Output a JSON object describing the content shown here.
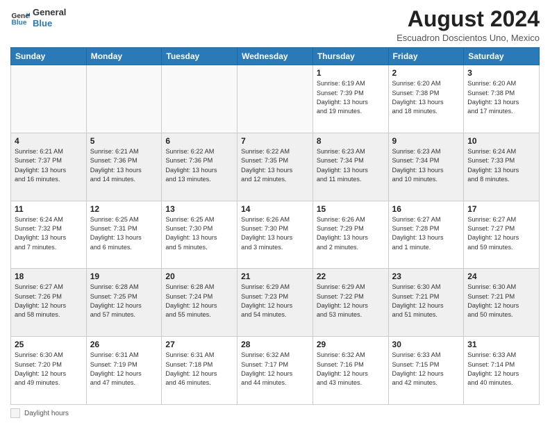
{
  "header": {
    "logo_line1": "General",
    "logo_line2": "Blue",
    "main_title": "August 2024",
    "subtitle": "Escuadron Doscientos Uno, Mexico"
  },
  "columns": [
    "Sunday",
    "Monday",
    "Tuesday",
    "Wednesday",
    "Thursday",
    "Friday",
    "Saturday"
  ],
  "weeks": [
    [
      {
        "day": "",
        "info": ""
      },
      {
        "day": "",
        "info": ""
      },
      {
        "day": "",
        "info": ""
      },
      {
        "day": "",
        "info": ""
      },
      {
        "day": "1",
        "info": "Sunrise: 6:19 AM\nSunset: 7:39 PM\nDaylight: 13 hours\nand 19 minutes."
      },
      {
        "day": "2",
        "info": "Sunrise: 6:20 AM\nSunset: 7:38 PM\nDaylight: 13 hours\nand 18 minutes."
      },
      {
        "day": "3",
        "info": "Sunrise: 6:20 AM\nSunset: 7:38 PM\nDaylight: 13 hours\nand 17 minutes."
      }
    ],
    [
      {
        "day": "4",
        "info": "Sunrise: 6:21 AM\nSunset: 7:37 PM\nDaylight: 13 hours\nand 16 minutes."
      },
      {
        "day": "5",
        "info": "Sunrise: 6:21 AM\nSunset: 7:36 PM\nDaylight: 13 hours\nand 14 minutes."
      },
      {
        "day": "6",
        "info": "Sunrise: 6:22 AM\nSunset: 7:36 PM\nDaylight: 13 hours\nand 13 minutes."
      },
      {
        "day": "7",
        "info": "Sunrise: 6:22 AM\nSunset: 7:35 PM\nDaylight: 13 hours\nand 12 minutes."
      },
      {
        "day": "8",
        "info": "Sunrise: 6:23 AM\nSunset: 7:34 PM\nDaylight: 13 hours\nand 11 minutes."
      },
      {
        "day": "9",
        "info": "Sunrise: 6:23 AM\nSunset: 7:34 PM\nDaylight: 13 hours\nand 10 minutes."
      },
      {
        "day": "10",
        "info": "Sunrise: 6:24 AM\nSunset: 7:33 PM\nDaylight: 13 hours\nand 8 minutes."
      }
    ],
    [
      {
        "day": "11",
        "info": "Sunrise: 6:24 AM\nSunset: 7:32 PM\nDaylight: 13 hours\nand 7 minutes."
      },
      {
        "day": "12",
        "info": "Sunrise: 6:25 AM\nSunset: 7:31 PM\nDaylight: 13 hours\nand 6 minutes."
      },
      {
        "day": "13",
        "info": "Sunrise: 6:25 AM\nSunset: 7:30 PM\nDaylight: 13 hours\nand 5 minutes."
      },
      {
        "day": "14",
        "info": "Sunrise: 6:26 AM\nSunset: 7:30 PM\nDaylight: 13 hours\nand 3 minutes."
      },
      {
        "day": "15",
        "info": "Sunrise: 6:26 AM\nSunset: 7:29 PM\nDaylight: 13 hours\nand 2 minutes."
      },
      {
        "day": "16",
        "info": "Sunrise: 6:27 AM\nSunset: 7:28 PM\nDaylight: 13 hours\nand 1 minute."
      },
      {
        "day": "17",
        "info": "Sunrise: 6:27 AM\nSunset: 7:27 PM\nDaylight: 12 hours\nand 59 minutes."
      }
    ],
    [
      {
        "day": "18",
        "info": "Sunrise: 6:27 AM\nSunset: 7:26 PM\nDaylight: 12 hours\nand 58 minutes."
      },
      {
        "day": "19",
        "info": "Sunrise: 6:28 AM\nSunset: 7:25 PM\nDaylight: 12 hours\nand 57 minutes."
      },
      {
        "day": "20",
        "info": "Sunrise: 6:28 AM\nSunset: 7:24 PM\nDaylight: 12 hours\nand 55 minutes."
      },
      {
        "day": "21",
        "info": "Sunrise: 6:29 AM\nSunset: 7:23 PM\nDaylight: 12 hours\nand 54 minutes."
      },
      {
        "day": "22",
        "info": "Sunrise: 6:29 AM\nSunset: 7:22 PM\nDaylight: 12 hours\nand 53 minutes."
      },
      {
        "day": "23",
        "info": "Sunrise: 6:30 AM\nSunset: 7:21 PM\nDaylight: 12 hours\nand 51 minutes."
      },
      {
        "day": "24",
        "info": "Sunrise: 6:30 AM\nSunset: 7:21 PM\nDaylight: 12 hours\nand 50 minutes."
      }
    ],
    [
      {
        "day": "25",
        "info": "Sunrise: 6:30 AM\nSunset: 7:20 PM\nDaylight: 12 hours\nand 49 minutes."
      },
      {
        "day": "26",
        "info": "Sunrise: 6:31 AM\nSunset: 7:19 PM\nDaylight: 12 hours\nand 47 minutes."
      },
      {
        "day": "27",
        "info": "Sunrise: 6:31 AM\nSunset: 7:18 PM\nDaylight: 12 hours\nand 46 minutes."
      },
      {
        "day": "28",
        "info": "Sunrise: 6:32 AM\nSunset: 7:17 PM\nDaylight: 12 hours\nand 44 minutes."
      },
      {
        "day": "29",
        "info": "Sunrise: 6:32 AM\nSunset: 7:16 PM\nDaylight: 12 hours\nand 43 minutes."
      },
      {
        "day": "30",
        "info": "Sunrise: 6:33 AM\nSunset: 7:15 PM\nDaylight: 12 hours\nand 42 minutes."
      },
      {
        "day": "31",
        "info": "Sunrise: 6:33 AM\nSunset: 7:14 PM\nDaylight: 12 hours\nand 40 minutes."
      }
    ]
  ],
  "footer": {
    "label": "Daylight hours"
  }
}
